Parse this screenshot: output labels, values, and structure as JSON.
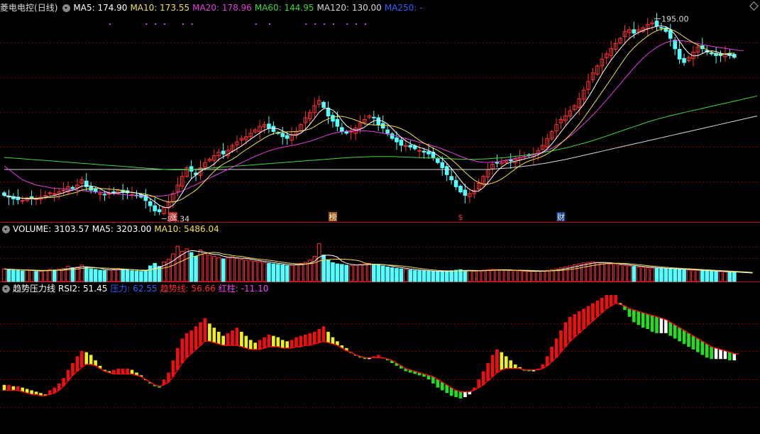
{
  "main": {
    "stock": "菱电电控",
    "period": "(日线)",
    "indicators": [
      {
        "label": "MA5: 174.90",
        "color": "#ffffff"
      },
      {
        "label": "MA10: 173.55",
        "color": "#f2e14c"
      },
      {
        "label": "MA20: 178.96",
        "color": "#e040e0"
      },
      {
        "label": "MA60: 144.95",
        "color": "#40d840"
      },
      {
        "label": "MA120: 130.00",
        "color": "#d8d8d8"
      },
      {
        "label": "MA250: -",
        "color": "#3060ff"
      }
    ],
    "high_label": "195.00",
    "low_label": "84.34",
    "markers": [
      {
        "text": "涨",
        "i": 37,
        "color": "#e6e6e6",
        "bg": "#d83030"
      },
      {
        "text": "榜",
        "i": 72,
        "color": "#e6e6e6",
        "bg": "#c07010"
      },
      {
        "text": "$",
        "i": 100,
        "color": "#ff3030",
        "bg": ""
      },
      {
        "text": "财",
        "i": 122,
        "color": "#e6e6e6",
        "bg": "#2050a0"
      }
    ]
  },
  "volume": {
    "labels": [
      {
        "label": "VOLUME: 3103.57",
        "color": "#ffffff"
      },
      {
        "label": "MA5: 3203.00",
        "color": "#ffffff"
      },
      {
        "label": "MA10: 5486.04",
        "color": "#f2e14c"
      }
    ]
  },
  "rsi": {
    "labels": [
      {
        "label": "趋势压力线",
        "color": "#ffffff"
      },
      {
        "label": "RSI2: 51.45",
        "color": "#ffffff"
      },
      {
        "label": "压力: 62.55",
        "color": "#3060ff"
      },
      {
        "label": "趋势线: 56.66",
        "color": "#ff3030"
      },
      {
        "label": "红柱: -11.10",
        "color": "#ff40ff"
      }
    ]
  },
  "colors": {
    "up": "#ff3232",
    "down": "#54ffff",
    "grid": "#7a0000",
    "ma5": "#ffffff",
    "ma10": "#f2e14c",
    "ma20": "#e040e0",
    "ma60": "#40d840",
    "ma120": "#d8d8d8",
    "bar_red": "#ee1010",
    "bar_green": "#20e020",
    "bar_yellow": "#f0f020",
    "bar_white": "#ffffff"
  },
  "chart_data": [
    {
      "type": "candlestick",
      "title": "菱电电控(日线)",
      "ylim": [
        80,
        200
      ],
      "close": [
        95,
        94,
        93,
        92.5,
        92,
        93.5,
        94,
        93,
        94,
        95,
        96.5,
        96,
        97,
        98,
        100,
        99,
        101,
        104,
        100,
        98,
        97,
        96,
        95.5,
        96,
        97,
        98,
        97,
        96.5,
        95.5,
        95,
        94,
        92,
        89,
        86,
        85.5,
        88,
        91,
        96,
        101,
        106,
        111,
        109,
        107,
        111,
        114,
        116,
        118,
        120,
        119,
        121,
        124,
        126,
        128,
        129,
        131,
        133,
        135,
        136,
        134,
        132,
        131,
        129,
        128,
        130,
        132,
        136,
        140,
        143,
        147,
        150,
        146,
        141,
        138,
        135,
        132,
        131,
        132,
        134,
        137,
        139,
        141,
        140,
        136,
        134,
        131,
        128,
        126,
        124,
        124,
        123,
        122,
        121,
        120,
        119,
        117,
        114,
        111,
        107,
        104,
        100,
        97,
        95,
        96,
        98,
        102,
        106,
        110,
        113,
        114,
        114,
        115,
        115,
        116,
        117,
        117.5,
        118,
        119,
        121,
        124,
        128,
        132,
        136,
        139,
        141,
        144,
        147,
        151,
        156,
        161,
        166,
        170,
        174,
        177,
        180,
        183,
        186,
        190,
        191,
        189,
        191,
        192,
        194,
        195,
        193,
        192,
        190,
        186,
        180,
        174,
        172,
        175,
        178,
        181,
        180,
        178,
        177,
        176,
        176,
        177,
        176,
        175
      ],
      "ma20": [
        112,
        110,
        108,
        106,
        104,
        103,
        102,
        101,
        100.5,
        100,
        99.5,
        99,
        99,
        98.8,
        98.6,
        98.3,
        98,
        97.8,
        97.5,
        97.2,
        97,
        96.8,
        96.5,
        96.3,
        96,
        95.8,
        95.5,
        95.2,
        95,
        94.8,
        94.7,
        94.6,
        94.5,
        94.5,
        94.6,
        94.8,
        95.2,
        95.8,
        96.6,
        97.6,
        98.8,
        100,
        101.2,
        102.5,
        103.8,
        105,
        106.3,
        107.5,
        108.8,
        110,
        111.3,
        112.6,
        114,
        115.2,
        116.4,
        117.6,
        118.7,
        119.8,
        120.8,
        121.6,
        122.3,
        122.9,
        123.4,
        123.9,
        124.4,
        125,
        125.7,
        126.4,
        127.2,
        128.2,
        129.2,
        130.1,
        130.9,
        131.5,
        131.9,
        132.2,
        132.4,
        132.5,
        132.5,
        132.4,
        132.2,
        131.9,
        131.5,
        131,
        130.5,
        129.9,
        129.3,
        128.6,
        127.9,
        127.2,
        126.5,
        125.8,
        125.1,
        124.4,
        123.6,
        122.8,
        121.9,
        120.9,
        119.8,
        118.7,
        117.6,
        116.6,
        115.7,
        115,
        114.5,
        114.2,
        114.1,
        114.2,
        114.5,
        114.9,
        115.4,
        115.9,
        116.4,
        116.9,
        117.4,
        117.9,
        118.5,
        119.2,
        120,
        121,
        122.3,
        123.8,
        125.5,
        127.4,
        129.4,
        131.6,
        133.9,
        136.3,
        138.9,
        141.6,
        144.4,
        147.3,
        150.3,
        153.4,
        156.5,
        159.6,
        162.8,
        165.9,
        168.9,
        171.8,
        174.5,
        176.9,
        179,
        180.8,
        182.3,
        183.5,
        184.3,
        184.6,
        184.7,
        184.5,
        184.1,
        183.6,
        183,
        182.4,
        181.9,
        181.4,
        181,
        180.6,
        180.2,
        179.8,
        179.4,
        179,
        178.96
      ],
      "ma60": [
        117,
        116.8,
        116.6,
        116.4,
        116.2,
        116,
        115.8,
        115.6,
        115.4,
        115.2,
        115,
        114.8,
        114.6,
        114.4,
        114.2,
        114,
        113.8,
        113.6,
        113.4,
        113.2,
        113,
        112.8,
        112.6,
        112.4,
        112.2,
        112,
        111.8,
        111.6,
        111.4,
        111.2,
        111,
        110.8,
        110.6,
        110.4,
        110.2,
        110,
        109.9,
        109.8,
        109.8,
        109.8,
        109.9,
        110,
        110.2,
        110.4,
        110.6,
        110.8,
        111,
        111.2,
        111.4,
        111.6,
        111.8,
        112,
        112.2,
        112.4,
        112.6,
        112.8,
        113,
        113.2,
        113.4,
        113.6,
        113.8,
        114,
        114.2,
        114.4,
        114.6,
        114.8,
        115,
        115.2,
        115.4,
        115.6,
        115.8,
        116,
        116.2,
        116.4,
        116.6,
        116.8,
        117,
        117.1,
        117.2,
        117.3,
        117.4,
        117.5,
        117.5,
        117.5,
        117.5,
        117.5,
        117.4,
        117.3,
        117.2,
        117.1,
        117,
        116.9,
        116.8,
        116.7,
        116.6,
        116.5,
        116.4,
        116.3,
        116.2,
        116.1,
        116,
        115.9,
        115.9,
        115.9,
        116,
        116.1,
        116.2,
        116.4,
        116.6,
        116.8,
        117,
        117.3,
        117.6,
        117.9,
        118.2,
        118.6,
        119,
        119.4,
        119.8,
        120.3,
        120.8,
        121.3,
        121.9,
        122.5,
        123.1,
        123.8,
        124.5,
        125.2,
        126,
        126.8,
        127.6,
        128.5,
        129.4,
        130.3,
        131.2,
        132.1,
        133,
        133.9,
        134.8,
        135.7,
        136.6,
        137.5,
        138.3,
        139.1,
        139.8,
        140.5,
        141.2,
        141.8,
        142.4,
        143,
        143.6,
        144.2,
        144.8,
        145.4,
        146,
        146.6,
        147.2,
        147.8,
        148.4,
        149,
        149.6,
        150.2,
        150.8,
        151.4,
        152,
        152.6
      ],
      "ma120": [
        110,
        110,
        110,
        110,
        110,
        110,
        110,
        110,
        110,
        110,
        110,
        110,
        110,
        110,
        110,
        110,
        110,
        110,
        110,
        110,
        110,
        110,
        110,
        110,
        110,
        110,
        110,
        110,
        110,
        110,
        110,
        110,
        110,
        110,
        110,
        110,
        110,
        110,
        110,
        110,
        110,
        110,
        110,
        110,
        110,
        110,
        110,
        110,
        110,
        110,
        110,
        110,
        110,
        110,
        110,
        110,
        110,
        110,
        110,
        110,
        110,
        110,
        110,
        110,
        110,
        110,
        110,
        110,
        110,
        110,
        110,
        110,
        110,
        110,
        110,
        110,
        110,
        110,
        110,
        110,
        110,
        110,
        110,
        110,
        110,
        110,
        110,
        110,
        110,
        110,
        110,
        110,
        110,
        110,
        110,
        110,
        110,
        110,
        110,
        110,
        110,
        110,
        110,
        110,
        110,
        110,
        110,
        110.2,
        110.4,
        110.6,
        110.8,
        111,
        111.3,
        111.6,
        111.9,
        112.2,
        112.6,
        113,
        113.4,
        113.8,
        114.3,
        114.8,
        115.3,
        115.8,
        116.4,
        117,
        117.6,
        118.2,
        118.8,
        119.4,
        120,
        120.6,
        121.2,
        121.8,
        122.4,
        123,
        123.6,
        124.2,
        124.8,
        125.4,
        126,
        126.6,
        127.2,
        127.8,
        128.4,
        129,
        129.6,
        130.2,
        130.8,
        131.4,
        132,
        132.6,
        133.2,
        133.8,
        134.4,
        135,
        135.6,
        136.2,
        136.8,
        137.4,
        138,
        138.6,
        139.2,
        139.8,
        140.4,
        141
      ]
    },
    {
      "type": "bar",
      "title": "VOLUME",
      "ylim": [
        0,
        18000
      ],
      "values": [
        5000,
        4800,
        4600,
        4400,
        4200,
        4600,
        4400,
        4000,
        4100,
        4300,
        4800,
        4600,
        4900,
        5200,
        6000,
        5500,
        5800,
        6500,
        5600,
        5000,
        4800,
        4500,
        4400,
        4600,
        4900,
        5100,
        4800,
        4600,
        4300,
        4200,
        4000,
        4500,
        6200,
        7200,
        6000,
        7800,
        8800,
        11000,
        14000,
        12000,
        13000,
        11500,
        10000,
        12500,
        11000,
        10500,
        10000,
        9500,
        9000,
        9500,
        9800,
        9200,
        8800,
        8500,
        8200,
        8000,
        7800,
        7500,
        7200,
        7000,
        6800,
        6600,
        6300,
        6500,
        6800,
        7200,
        7600,
        8500,
        10000,
        15000,
        10500,
        8500,
        7500,
        7000,
        6800,
        6500,
        6300,
        6500,
        6800,
        7000,
        7200,
        6800,
        6500,
        6200,
        5800,
        5500,
        5200,
        5000,
        4800,
        4600,
        4400,
        4300,
        4200,
        4100,
        4000,
        3900,
        4000,
        4100,
        4300,
        4500,
        4700,
        4400,
        4200,
        4100,
        4300,
        4500,
        4700,
        4800,
        4700,
        4600,
        4500,
        4400,
        4300,
        4200,
        4100,
        4000,
        4000,
        4100,
        4200,
        4400,
        4700,
        5000,
        5400,
        5800,
        6200,
        6600,
        7000,
        7400,
        7600,
        7800,
        7600,
        7400,
        7200,
        7000,
        6800,
        6600,
        6400,
        6200,
        6000,
        5800,
        5600,
        5500,
        5400,
        5300,
        5200,
        5100,
        5000,
        4900,
        4800,
        4700,
        4600,
        4500,
        4400,
        4300,
        4200,
        4100,
        4000,
        3900,
        3800,
        3700,
        3600,
        3500,
        3400,
        3300,
        3103.57
      ]
    },
    {
      "type": "bar",
      "title": "趋势压力线",
      "ylim": [
        0,
        100
      ],
      "rsi2": [
        34,
        34,
        33,
        33,
        32,
        31,
        30,
        29,
        28,
        27,
        30,
        32,
        35,
        39,
        45,
        50,
        55,
        59,
        58,
        56,
        52,
        48,
        45,
        44,
        45,
        46,
        46,
        46,
        45,
        43,
        41,
        38,
        35,
        33,
        32,
        38,
        43,
        52,
        61,
        68,
        72,
        74,
        77,
        80,
        83,
        79,
        76,
        73,
        70,
        72,
        74,
        76,
        73,
        70,
        67,
        65,
        67,
        69,
        71,
        70,
        69,
        67,
        66,
        67,
        69,
        70,
        71,
        72,
        73,
        75,
        77,
        73,
        69,
        66,
        63,
        61,
        58,
        56,
        54,
        53,
        53,
        55,
        56,
        54,
        52,
        50,
        48,
        46,
        44,
        43,
        42,
        41,
        40,
        38,
        35,
        32,
        30,
        28,
        26,
        25,
        24,
        25,
        27,
        32,
        38,
        44,
        50,
        56,
        60,
        58,
        55,
        52,
        49,
        47,
        45,
        44,
        44,
        46,
        49,
        55,
        62,
        68,
        74,
        80,
        84,
        86,
        88,
        90,
        92,
        94,
        96,
        98,
        100,
        100,
        100,
        94,
        89,
        84,
        80,
        78,
        76,
        75,
        73,
        72,
        72,
        72,
        70,
        68,
        66,
        64,
        62,
        60,
        58,
        56,
        54,
        53,
        53,
        53,
        53,
        52,
        52,
        51.45
      ],
      "trend": [
        30,
        30,
        30,
        30,
        29,
        28,
        27,
        27,
        26,
        26,
        27,
        28,
        30,
        33,
        37,
        41,
        44,
        47,
        49,
        49,
        48,
        46,
        44,
        43,
        42,
        42,
        42,
        42,
        42,
        41,
        40,
        38,
        36,
        34,
        33,
        34,
        36,
        40,
        45,
        50,
        54,
        57,
        60,
        63,
        66,
        66,
        65,
        64,
        63,
        63,
        63,
        63,
        62,
        61,
        60,
        60,
        60,
        61,
        62,
        62,
        62,
        61,
        61,
        61,
        62,
        62,
        63,
        63,
        64,
        65,
        66,
        65,
        64,
        63,
        61,
        59,
        58,
        56,
        55,
        54,
        54,
        54,
        54,
        54,
        53,
        52,
        50,
        48,
        46,
        45,
        44,
        43,
        42,
        41,
        40,
        38,
        36,
        34,
        32,
        30,
        29,
        29,
        29,
        30,
        32,
        34,
        37,
        40,
        43,
        45,
        46,
        46,
        46,
        46,
        45,
        45,
        45,
        45,
        46,
        48,
        51,
        54,
        58,
        62,
        66,
        69,
        72,
        75,
        78,
        81,
        84,
        87,
        90,
        92,
        94,
        93,
        92,
        90,
        89,
        88,
        87,
        86,
        85,
        84,
        83,
        82,
        80,
        78,
        76,
        74,
        72,
        70,
        68,
        66,
        64,
        62,
        61,
        60,
        59,
        58,
        57,
        56.66
      ],
      "pressure": 62.55,
      "red_bar": -11.1,
      "rsi2_last": 51.45
    }
  ]
}
